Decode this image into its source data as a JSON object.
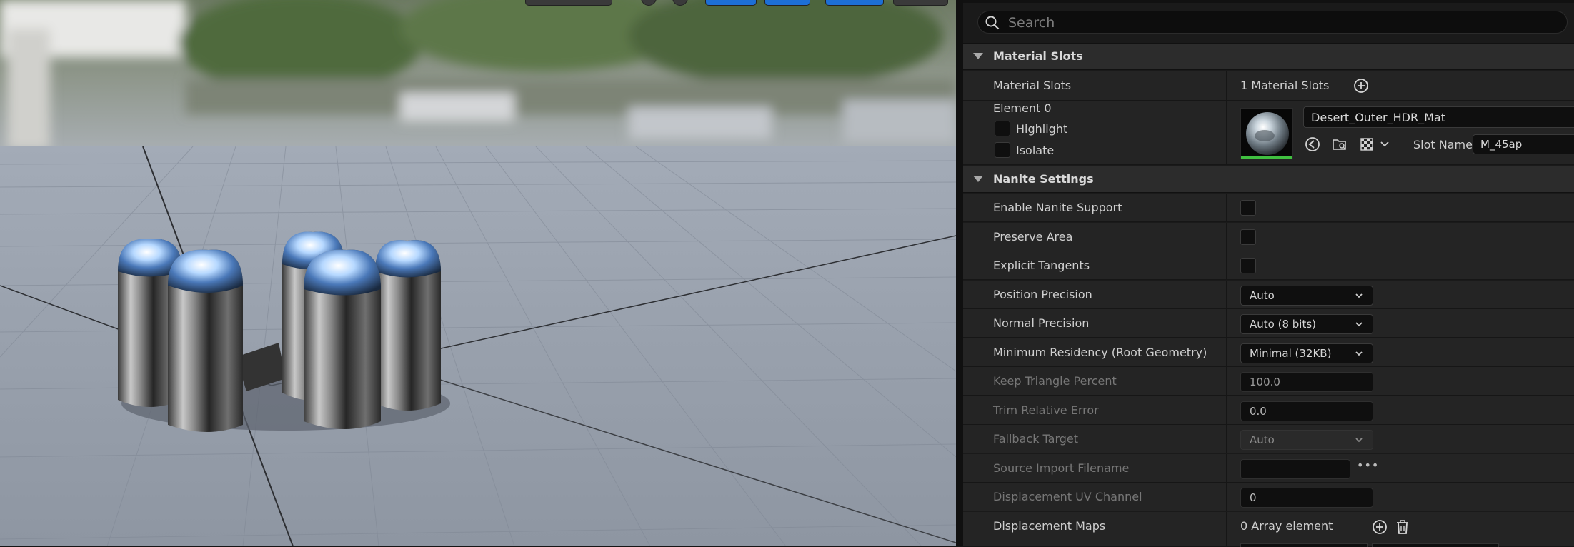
{
  "search": {
    "placeholder": "Search"
  },
  "material_slots": {
    "header": "Material Slots",
    "row_label": "Material Slots",
    "count_text": "1 Material Slots",
    "element": {
      "title": "Element 0",
      "highlight_label": "Highlight",
      "isolate_label": "Isolate",
      "material_name": "Desert_Outer_HDR_Mat",
      "slot_name_label": "Slot Name",
      "slot_name_value": "M_45ap"
    }
  },
  "nanite": {
    "header": "Nanite Settings",
    "enable_label": "Enable Nanite Support",
    "preserve_area_label": "Preserve Area",
    "explicit_tangents_label": "Explicit Tangents",
    "position_precision_label": "Position Precision",
    "position_precision_value": "Auto",
    "normal_precision_label": "Normal Precision",
    "normal_precision_value": "Auto (8 bits)",
    "min_residency_label": "Minimum Residency (Root Geometry)",
    "min_residency_value": "Minimal (32KB)",
    "keep_triangle_label": "Keep Triangle Percent",
    "keep_triangle_value": "100.0",
    "trim_error_label": "Trim Relative Error",
    "trim_error_value": "0.0",
    "fallback_label": "Fallback Target",
    "fallback_value": "Auto",
    "source_import_label": "Source Import Filename",
    "source_import_value": "",
    "displacement_uv_label": "Displacement UV Channel",
    "displacement_uv_value": "0",
    "displacement_maps_label": "Displacement Maps",
    "displacement_maps_value": "0 Array element"
  },
  "colors": {
    "panel_bg": "#1a1a1a",
    "row_bg": "#242424",
    "header_bg": "#2c2c2c",
    "accent_blue": "#1d6fd6",
    "thumb_green": "#40c040"
  },
  "icons": [
    "search-icon",
    "add-icon",
    "use-selected-icon",
    "browse-icon",
    "checker-icon",
    "chevron-down-icon",
    "trash-icon"
  ]
}
